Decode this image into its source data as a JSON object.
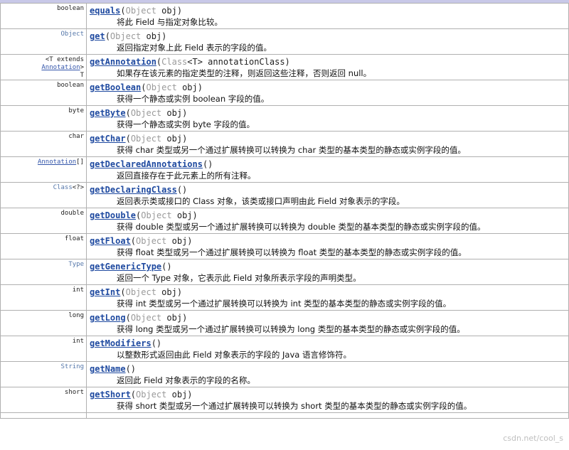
{
  "rows": [
    {
      "ret": "boolean",
      "name": "equals",
      "params_open": "(",
      "ptype": "Object",
      "params_rest": " obj)",
      "desc": "将此 Field 与指定对象比较。"
    },
    {
      "ret": "Object",
      "name": "get",
      "params_open": "(",
      "ptype": "Object",
      "params_rest": " obj)",
      "desc": "返回指定对象上此 Field 表示的字段的值。"
    },
    {
      "ret_line1": "<T extends ",
      "ret_link": "Annotation",
      "ret_close": ">",
      "ret_line2": "T",
      "name": "getAnnotation",
      "params_open": "(",
      "ptype": "Class",
      "params_rest": "<T> annotationClass)",
      "desc": "如果存在该元素的指定类型的注释，则返回这些注释，否则返回 null。"
    },
    {
      "ret": "boolean",
      "name": "getBoolean",
      "params_open": "(",
      "ptype": "Object",
      "params_rest": " obj)",
      "desc": "获得一个静态或实例 boolean 字段的值。"
    },
    {
      "ret": "byte",
      "name": "getByte",
      "params_open": "(",
      "ptype": "Object",
      "params_rest": " obj)",
      "desc": "获得一个静态或实例 byte 字段的值。"
    },
    {
      "ret": "char",
      "name": "getChar",
      "params_open": "(",
      "ptype": "Object",
      "params_rest": " obj)",
      "desc": "获得 char 类型或另一个通过扩展转换可以转换为 char 类型的基本类型的静态或实例字段的值。"
    },
    {
      "ret": "Annotation",
      "ret_suffix": "[]",
      "name": "getDeclaredAnnotations",
      "params_open": "()",
      "desc": "返回直接存在于此元素上的所有注释。"
    },
    {
      "ret": "Class",
      "ret_suffix": "<?>",
      "name": "getDeclaringClass",
      "params_open": "()",
      "desc": "返回表示类或接口的 Class 对象，该类或接口声明由此 Field 对象表示的字段。"
    },
    {
      "ret": "double",
      "name": "getDouble",
      "params_open": "(",
      "ptype": "Object",
      "params_rest": " obj)",
      "desc": "获得 double 类型或另一个通过扩展转换可以转换为 double 类型的基本类型的静态或实例字段的值。"
    },
    {
      "ret": "float",
      "name": "getFloat",
      "params_open": "(",
      "ptype": "Object",
      "params_rest": " obj)",
      "desc": "获得 float 类型或另一个通过扩展转换可以转换为 float 类型的基本类型的静态或实例字段的值。"
    },
    {
      "ret": "Type",
      "name": "getGenericType",
      "params_open": "()",
      "desc": "返回一个 Type 对象，它表示此 Field 对象所表示字段的声明类型。"
    },
    {
      "ret": "int",
      "name": "getInt",
      "params_open": "(",
      "ptype": "Object",
      "params_rest": " obj)",
      "desc": "获得 int 类型或另一个通过扩展转换可以转换为 int 类型的基本类型的静态或实例字段的值。"
    },
    {
      "ret": "long",
      "name": "getLong",
      "params_open": "(",
      "ptype": "Object",
      "params_rest": " obj)",
      "desc": "获得 long 类型或另一个通过扩展转换可以转换为 long 类型的基本类型的静态或实例字段的值。"
    },
    {
      "ret": "int",
      "name": "getModifiers",
      "params_open": "()",
      "desc": "以整数形式返回由此 Field 对象表示的字段的 Java 语言修饰符。"
    },
    {
      "ret": "String",
      "name": "getName",
      "params_open": "()",
      "desc": "返回此 Field 对象表示的字段的名称。"
    },
    {
      "ret": "short",
      "name": "getShort",
      "params_open": "(",
      "ptype": "Object",
      "params_rest": " obj)",
      "desc": "获得 short 类型或另一个通过扩展转换可以转换为 short 类型的基本类型的静态或实例字段的值。"
    }
  ],
  "watermark": "csdn.net/cool_s"
}
